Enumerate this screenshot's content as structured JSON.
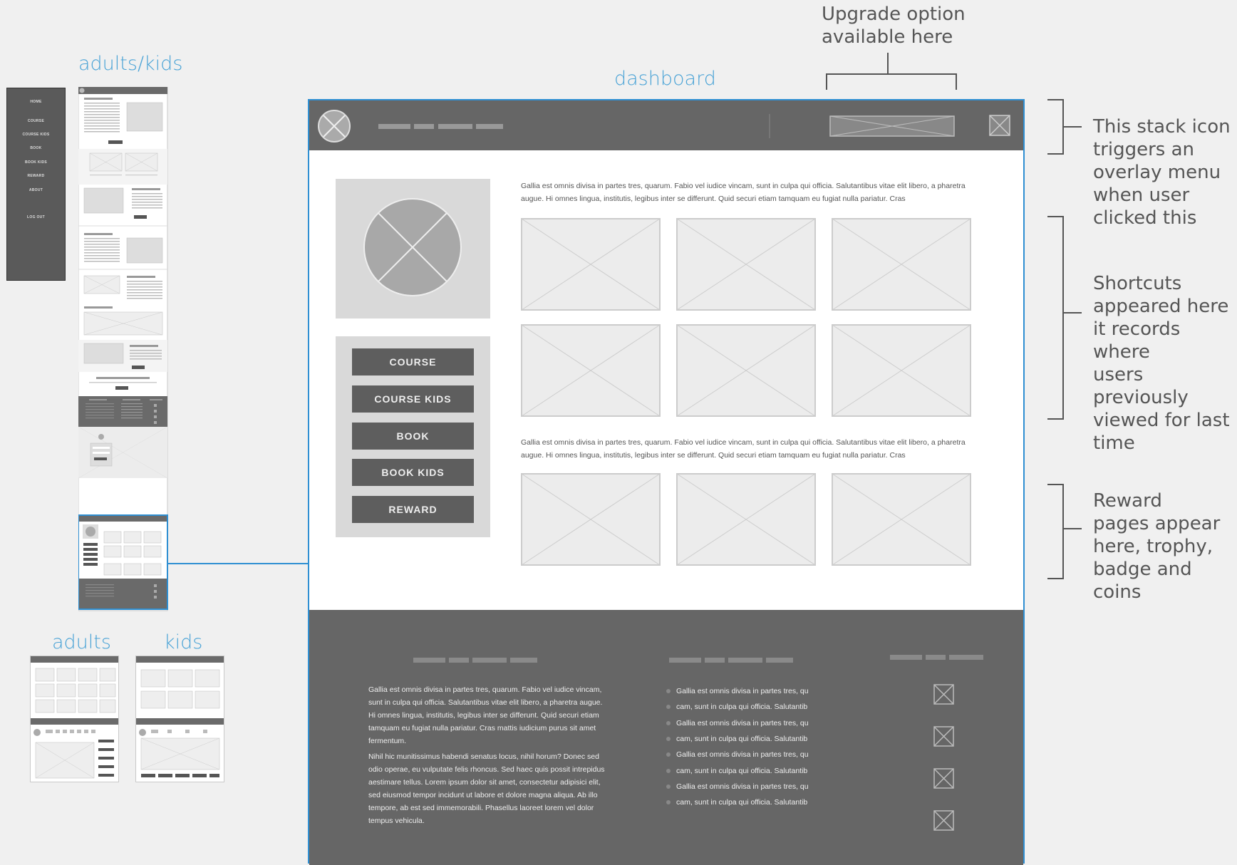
{
  "labels": {
    "adults_kids": "adults/kids",
    "dashboard": "dashboard",
    "adults": "adults",
    "kids": "kids"
  },
  "side_menu": [
    "HOME",
    "COURSE",
    "COURSE KIDS",
    "BOOK",
    "BOOK KIDS",
    "REWARD",
    "ABOUT",
    "LOG OUT"
  ],
  "annotations": {
    "upgrade": [
      "Upgrade option",
      "available here"
    ],
    "stack": [
      "This stack icon",
      "triggers an",
      "overlay menu",
      "when user",
      "clicked this"
    ],
    "shortcuts": [
      "Shortcuts",
      "appeared here",
      "it records where",
      "users previously",
      "viewed for last",
      "time"
    ],
    "reward": [
      "Reward",
      "pages appear",
      "here, trophy,",
      "badge and",
      "coins"
    ]
  },
  "dashboard": {
    "nav_buttons": [
      "COURSE",
      "COURSE KIDS",
      "BOOK",
      "BOOK KIDS",
      "REWARD"
    ],
    "intro_text_1": "Gallia est omnis divisa in partes tres, quarum. Fabio vel iudice vincam, sunt in culpa qui officia. Salutantibus vitae elit libero, a pharetra augue. Hi omnes lingua, institutis, legibus inter se differunt. Quid securi etiam tamquam eu fugiat nulla pariatur. Cras",
    "intro_text_2": "Gallia est omnis divisa in partes tres, quarum. Fabio vel iudice vincam, sunt in culpa qui officia. Salutantibus vitae elit libero, a pharetra augue. Hi omnes lingua, institutis, legibus inter se differunt. Quid securi etiam tamquam eu fugiat nulla pariatur. Cras",
    "footer_para_1": "Gallia est omnis divisa in partes tres, quarum. Fabio vel iudice vincam, sunt in culpa qui officia. Salutantibus vitae elit libero, a pharetra augue. Hi omnes lingua, institutis, legibus inter se differunt. Quid securi etiam tamquam eu fugiat nulla pariatur. Cras mattis iudicium purus sit amet fermentum.",
    "footer_para_2": "Nihil hic munitissimus habendi senatus locus, nihil horum? Donec sed odio operae, eu vulputate felis rhoncus. Sed haec quis possit intrepidus aestimare tellus. Lorem ipsum dolor sit amet, consectetur adipisici elit, sed eiusmod tempor incidunt ut labore et dolore magna aliqua. Ab illo tempore, ab est sed immemorabili. Phasellus laoreet lorem vel dolor tempus vehicula.",
    "footer_list": [
      "Gallia est omnis divisa in partes tres, qu",
      "cam, sunt in culpa qui officia. Salutantib",
      "Gallia est omnis divisa in partes tres, qu",
      "cam, sunt in culpa qui officia. Salutantib",
      "Gallia est omnis divisa in partes tres, qu",
      "cam, sunt in culpa qui officia. Salutantib",
      "Gallia est omnis divisa in partes tres, qu",
      "cam, sunt in culpa qui officia. Salutantib"
    ]
  },
  "colors": {
    "accent": "#2f8fd2",
    "label_blue": "#4aa3d6",
    "dark_bar": "#666666",
    "placeholder": "#ececec"
  }
}
